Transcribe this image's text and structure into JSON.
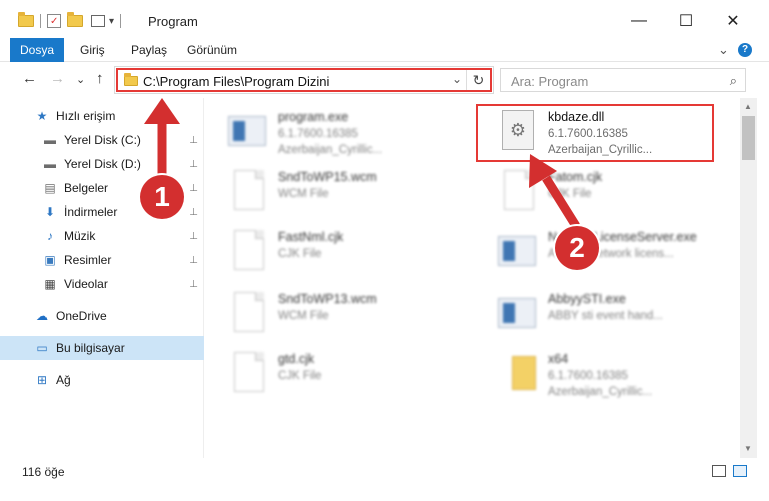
{
  "window": {
    "title": "Program",
    "minimize": "—",
    "maximize": "☐",
    "close": "✕"
  },
  "ribbon": {
    "tabs": [
      "Dosya",
      "Giriş",
      "Paylaş",
      "Görünüm"
    ],
    "expand": "⌄",
    "help": "?"
  },
  "nav": {
    "back": "←",
    "forward": "→",
    "recent": "⌄",
    "up": "↑",
    "address": "C:\\Program Files\\Program Dizini",
    "address_dropdown": "⌄",
    "refresh": "↻",
    "search_placeholder": "Ara: Program",
    "search_icon": "⌕"
  },
  "sidebar": {
    "items": [
      {
        "label": "Hızlı erişim",
        "icon": "star-icon",
        "glyph": "★",
        "color": "#2f78c4"
      },
      {
        "label": "Yerel Disk (C:)",
        "icon": "drive-icon",
        "glyph": "▬",
        "color": "#6d6d6d",
        "pinned": true
      },
      {
        "label": "Yerel Disk (D:)",
        "icon": "drive-icon",
        "glyph": "▬",
        "color": "#6d6d6d",
        "pinned": true
      },
      {
        "label": "Belgeler",
        "icon": "documents-icon",
        "glyph": "▤",
        "color": "#6d6d6d",
        "pinned": true
      },
      {
        "label": "İndirmeler",
        "icon": "downloads-icon",
        "glyph": "⬇",
        "color": "#2f78c4",
        "pinned": true
      },
      {
        "label": "Müzik",
        "icon": "music-icon",
        "glyph": "♪",
        "color": "#2f78c4",
        "pinned": true
      },
      {
        "label": "Resimler",
        "icon": "pictures-icon",
        "glyph": "▣",
        "color": "#3a7bbf",
        "pinned": true
      },
      {
        "label": "Videolar",
        "icon": "videos-icon",
        "glyph": "▦",
        "color": "#444",
        "pinned": true
      },
      {
        "label": "OneDrive",
        "icon": "onedrive-icon",
        "glyph": "☁",
        "color": "#1f6fc5"
      },
      {
        "label": "Bu bilgisayar",
        "icon": "computer-icon",
        "glyph": "▭",
        "color": "#2f78c4"
      },
      {
        "label": "Ağ",
        "icon": "network-icon",
        "glyph": "⊞",
        "color": "#2f78c4"
      }
    ],
    "pin_glyph": "📌"
  },
  "files": [
    {
      "name": "program.exe",
      "sub": "6.1.7600.16385",
      "sub2": "Azerbaijan_Cyrillic...",
      "type": "exe",
      "blur": true
    },
    {
      "name": "kbdaze.dll",
      "sub": "6.1.7600.16385",
      "sub2": "Azerbaijan_Cyrillic...",
      "type": "dll",
      "blur": false
    },
    {
      "name": "SndToWP15.wcm",
      "sub": "WCM File",
      "sub2": "",
      "type": "doc",
      "blur": true
    },
    {
      "name": "Fatom.cjk",
      "sub": "CJK File",
      "sub2": "",
      "type": "doc",
      "blur": true
    },
    {
      "name": "FastNml.cjk",
      "sub": "CJK File",
      "sub2": "",
      "type": "doc",
      "blur": true
    },
    {
      "name": "NetworkLicenseServer.exe",
      "sub": "ABBYY Network licens...",
      "sub2": "",
      "type": "exe",
      "blur": true
    },
    {
      "name": "SndToWP13.wcm",
      "sub": "WCM File",
      "sub2": "",
      "type": "doc",
      "blur": true
    },
    {
      "name": "AbbyySTI.exe",
      "sub": "ABBY sti event hand...",
      "sub2": "",
      "type": "exe",
      "blur": true
    },
    {
      "name": "gtd.cjk",
      "sub": "CJK File",
      "sub2": "",
      "type": "doc",
      "blur": true
    },
    {
      "name": "x64",
      "sub": "6.1.7600.16385",
      "sub2": "Azerbaijan_Cyrillic...",
      "type": "folder",
      "blur": true
    }
  ],
  "status": {
    "count": "116 öğe"
  },
  "callouts": [
    "1",
    "2"
  ],
  "colors": {
    "accent": "#1979ca",
    "highlight": "#e53935",
    "callout": "#d32f2f",
    "selected_bg": "#cce4f7"
  }
}
